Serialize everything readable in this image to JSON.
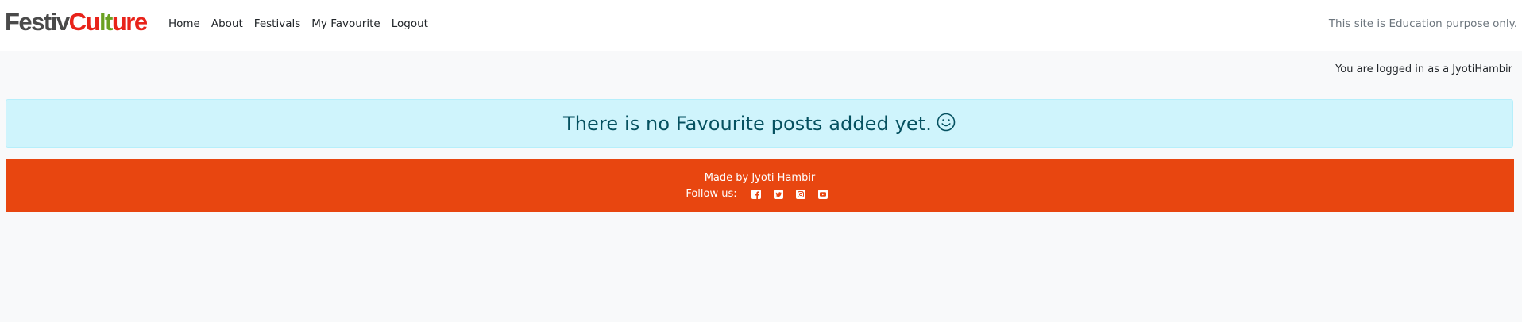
{
  "navbar": {
    "brand_part1": "Festiv",
    "brand_part2_a": "Cu",
    "brand_part2_b": "lt",
    "brand_part2_c": "ure",
    "links": [
      {
        "label": "Home"
      },
      {
        "label": "About"
      },
      {
        "label": "Festivals"
      },
      {
        "label": "My Favourite"
      },
      {
        "label": "Logout"
      }
    ],
    "disclaimer": "This site is Education purpose only."
  },
  "status": {
    "login_text": "You are logged in as a JyotiHambir"
  },
  "alert": {
    "message": "There is no Favourite posts added yet."
  },
  "footer": {
    "credit": "Made by Jyoti Hambir",
    "follow_label": "Follow us:",
    "social_icons": [
      "facebook-icon",
      "twitter-icon",
      "instagram-icon",
      "youtube-icon"
    ]
  },
  "colors": {
    "footer_bg": "#e84610",
    "alert_bg": "#cff4fc",
    "alert_text": "#055160",
    "brand_dark": "#4a4a4a",
    "brand_red": "#e8231a",
    "brand_green": "#6aa121"
  }
}
